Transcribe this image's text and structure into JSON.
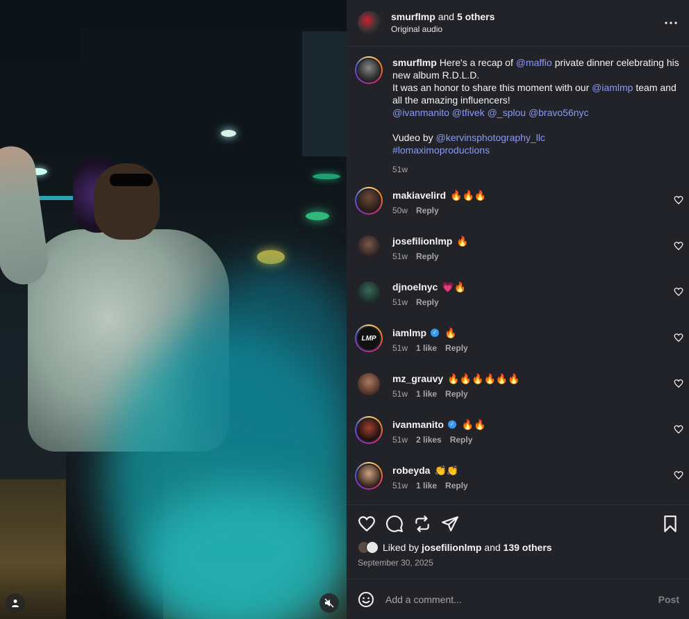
{
  "header": {
    "username": "smurflmp",
    "and_text": "and",
    "others": "5 others",
    "audio": "Original audio",
    "more_icon": "ellipsis-icon"
  },
  "caption": {
    "username": "smurflmp",
    "text_1": "Here's a recap of",
    "mention_1": "@maffio",
    "text_2": "private dinner celebrating his new album R.D.L.D.",
    "text_3": "It was an honor to share this moment with our",
    "mention_2": "@iamlmp",
    "text_4": "team and all the amazing influencers!",
    "mentions_line": "@ivanmanito @tfivek @_splou @bravo56nyc",
    "vudeo_label": "Vudeo by",
    "mention_3": "@kervinsphotography_llc",
    "hashtag": "#lomaximoproductions",
    "time": "51w"
  },
  "comments": [
    {
      "user": "makiavelird",
      "text": "🔥🔥🔥",
      "time": "50w",
      "likes": "",
      "reply": "Reply",
      "verified": false
    },
    {
      "user": "josefilionlmp",
      "text": "🔥",
      "time": "51w",
      "likes": "",
      "reply": "Reply",
      "verified": false
    },
    {
      "user": "djnoelnyc",
      "text": "💗🔥",
      "time": "51w",
      "likes": "",
      "reply": "Reply",
      "verified": false
    },
    {
      "user": "iamlmp",
      "text": "🔥",
      "time": "51w",
      "likes": "1 like",
      "reply": "Reply",
      "verified": true
    },
    {
      "user": "mz_grauvy",
      "text": "🔥🔥🔥🔥🔥🔥",
      "time": "51w",
      "likes": "1 like",
      "reply": "Reply",
      "verified": false
    },
    {
      "user": "ivanmanito",
      "text": "🔥🔥",
      "time": "51w",
      "likes": "2 likes",
      "reply": "Reply",
      "verified": true
    },
    {
      "user": "robeyda",
      "text": "👏👏",
      "time": "51w",
      "likes": "1 like",
      "reply": "Reply",
      "verified": false
    }
  ],
  "footer": {
    "liked_by": "Liked by",
    "liked_user": "josefilionlmp",
    "and": "and",
    "others": "139 others",
    "date": "September 30, 2025",
    "comment_placeholder": "Add a comment...",
    "post_label": "Post"
  },
  "colors": {
    "panel_bg": "#212328",
    "mention": "#8c99f6",
    "muted": "#a8a8a8"
  }
}
